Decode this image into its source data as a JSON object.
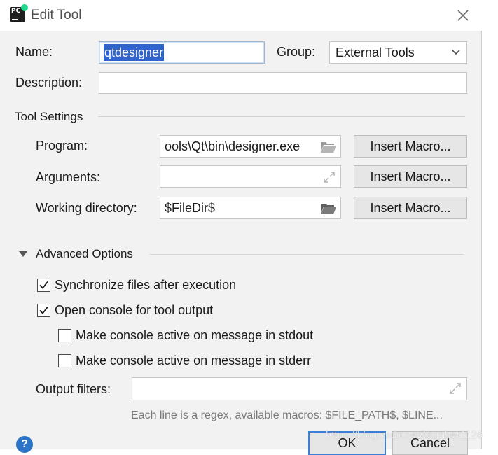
{
  "window": {
    "title": "Edit Tool"
  },
  "form": {
    "name_label": "Name:",
    "name_value": "qtdesigner",
    "group_label": "Group:",
    "group_value": "External Tools",
    "description_label": "Description:",
    "description_value": ""
  },
  "tool_settings": {
    "title": "Tool Settings",
    "program_label": "Program:",
    "program_value": "ools\\Qt\\bin\\designer.exe",
    "arguments_label": "Arguments:",
    "arguments_value": "",
    "working_dir_label": "Working directory:",
    "working_dir_value": "$FileDir$",
    "insert_macro_label": "Insert Macro..."
  },
  "advanced": {
    "title": "Advanced Options",
    "sync_files": {
      "label": "Synchronize files after execution",
      "checked": true
    },
    "open_console": {
      "label": "Open console for tool output",
      "checked": true
    },
    "active_stdout": {
      "label": "Make console active on message in stdout",
      "checked": false
    },
    "active_stderr": {
      "label": "Make console active on message in stderr",
      "checked": false
    },
    "output_filters_label": "Output filters:",
    "output_filters_value": "",
    "hint": "Each line is a regex, available macros: $FILE_PATH$, $LINE..."
  },
  "footer": {
    "help_glyph": "?",
    "ok_label": "OK",
    "cancel_label": "Cancel",
    "watermark": "https://blog.csdn.net/Number1126"
  },
  "colors": {
    "dialog_bg": "#f2f2f2",
    "selection": "#2f65ca",
    "focus_border": "#3c7fd6",
    "help_icon": "#2b74c7"
  },
  "icons": [
    "pycharm-icon",
    "close-icon",
    "chevron-down-icon",
    "folder-icon",
    "expand-icon",
    "collapse-triangle-icon",
    "checkmark-icon",
    "help-icon"
  ]
}
